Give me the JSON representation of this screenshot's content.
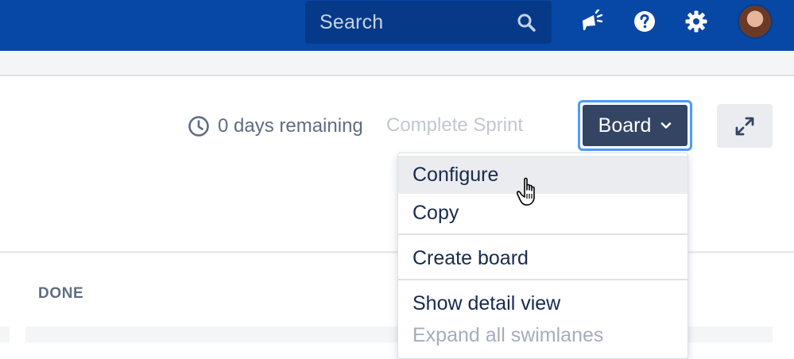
{
  "topbar": {
    "search": {
      "placeholder": "Search",
      "icon": "search-icon"
    },
    "icons": [
      "megaphone-icon",
      "help-icon",
      "gear-icon"
    ],
    "avatar": "avatar"
  },
  "sprint": {
    "remaining": "0 days remaining",
    "complete_label": "Complete Sprint"
  },
  "board_button": {
    "label": "Board",
    "icon": "chevron-down-icon"
  },
  "expand_button": {
    "icon": "expand-icon"
  },
  "menu": {
    "items": [
      {
        "label": "Configure"
      },
      {
        "label": "Copy"
      },
      {
        "label": "Create board"
      },
      {
        "label": "Show detail view"
      },
      {
        "label": "Expand all swimlanes"
      }
    ]
  },
  "columns": [
    {
      "header": "DONE"
    }
  ],
  "colors": {
    "brand": "#0747a6",
    "primary_button": "#344563",
    "focus_ring": "#4c9aff"
  }
}
